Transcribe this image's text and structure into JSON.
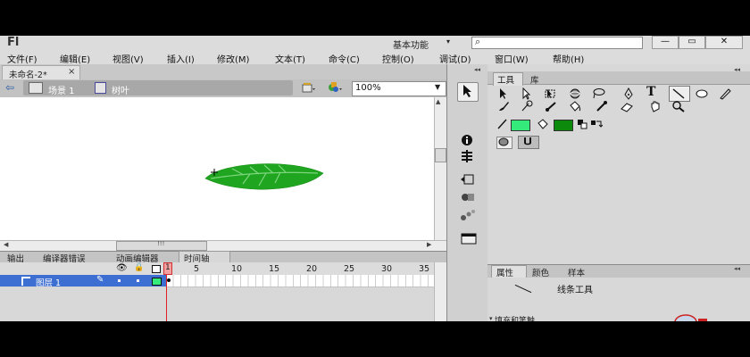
{
  "app": {
    "logo": "Fl",
    "workspace": "基本功能",
    "search_placeholder": "",
    "window_buttons": [
      "—",
      "▭",
      "✕"
    ]
  },
  "menu": [
    "文件(F)",
    "编辑(E)",
    "视图(V)",
    "插入(I)",
    "修改(M)",
    "文本(T)",
    "命令(C)",
    "控制(O)",
    "调试(D)",
    "窗口(W)",
    "帮助(H)"
  ],
  "document": {
    "tab_label": "未命名-2*",
    "close": "×"
  },
  "editbar": {
    "scene": "场景 1",
    "symbol": "树叶",
    "zoom": "100%"
  },
  "colors": {
    "leaf_fill": "#1fa51f",
    "leaf_vein": "#7ed67e",
    "stroke_color": "#33ea7a",
    "fill_color": "#0b8a0b",
    "layer_selected": "#3d6ed1"
  },
  "bottom_tabs": [
    "输出",
    "编译器错误",
    "动画编辑器",
    "时间轴"
  ],
  "timeline": {
    "ticks": [
      "1",
      "5",
      "10",
      "15",
      "20",
      "25",
      "30",
      "35"
    ],
    "layer_name": "图层 1",
    "current_frame": "1"
  },
  "tools_panel": {
    "tabs": [
      "工具",
      "库"
    ]
  },
  "props_panel": {
    "tabs": [
      "属性",
      "颜色",
      "样本"
    ],
    "tool_name": "线条工具",
    "section": "填充和笔触"
  },
  "scroll_grip": "!!!"
}
